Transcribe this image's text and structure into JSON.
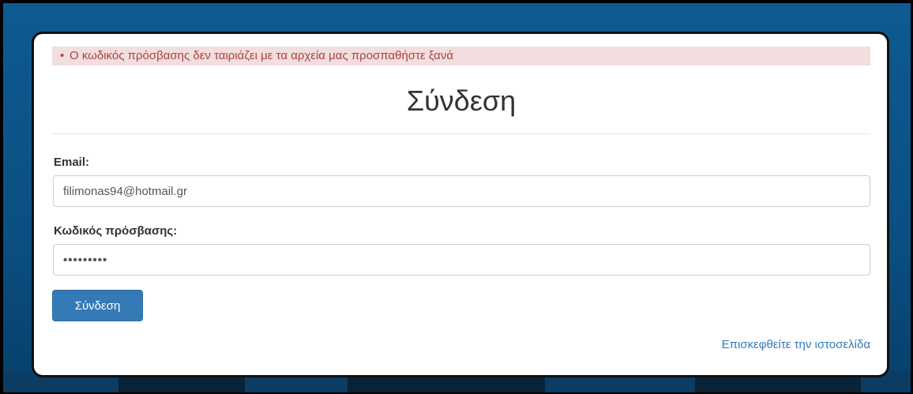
{
  "alert": {
    "bullet": "•",
    "message": "Ο κωδικός πρόσβασης δεν ταιριάζει με τα αρχεία μας προσπαθήστε ξανά"
  },
  "form": {
    "title": "Σύνδεση",
    "email_label": "Email:",
    "email_value": "filimonas94@hotmail.gr",
    "password_label": "Κωδικός πρόσβασης:",
    "password_value": "•••••••••",
    "submit_label": "Σύνδεση"
  },
  "footer": {
    "visit_link": "Επισκεφθείτε την ιστοσελίδα"
  },
  "colors": {
    "background": "#0b4f82",
    "alert_bg": "#f2dede",
    "alert_text": "#a94442",
    "button": "#337ab7",
    "link": "#337ab7"
  }
}
